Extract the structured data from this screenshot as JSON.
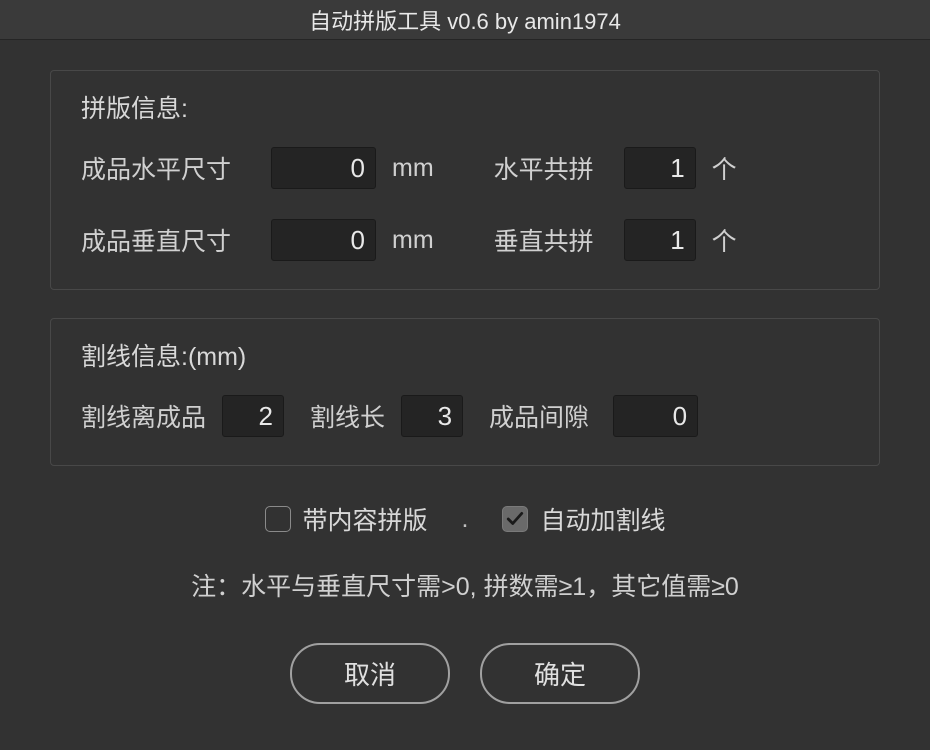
{
  "title": "自动拼版工具 v0.6   by amin1974",
  "panel_info": {
    "heading": "拼版信息:",
    "h_size_label": "成品水平尺寸",
    "h_size_value": "0",
    "h_size_unit": "mm",
    "h_count_label": "水平共拼",
    "h_count_value": "1",
    "h_count_unit": "个",
    "v_size_label": "成品垂直尺寸",
    "v_size_value": "0",
    "v_size_unit": "mm",
    "v_count_label": "垂直共拼",
    "v_count_value": "1",
    "v_count_unit": "个"
  },
  "cut_info": {
    "heading": "割线信息:(mm)",
    "offset_label": "割线离成品",
    "offset_value": "2",
    "length_label": "割线长",
    "length_value": "3",
    "gap_label": "成品间隙",
    "gap_value": "0"
  },
  "options": {
    "with_content_label": "带内容拼版",
    "with_content_checked": false,
    "separator": ".",
    "auto_cut_label": "自动加割线",
    "auto_cut_checked": true
  },
  "note": "注：水平与垂直尺寸需>0, 拼数需≥1，其它值需≥0",
  "buttons": {
    "cancel": "取消",
    "ok": "确定"
  }
}
